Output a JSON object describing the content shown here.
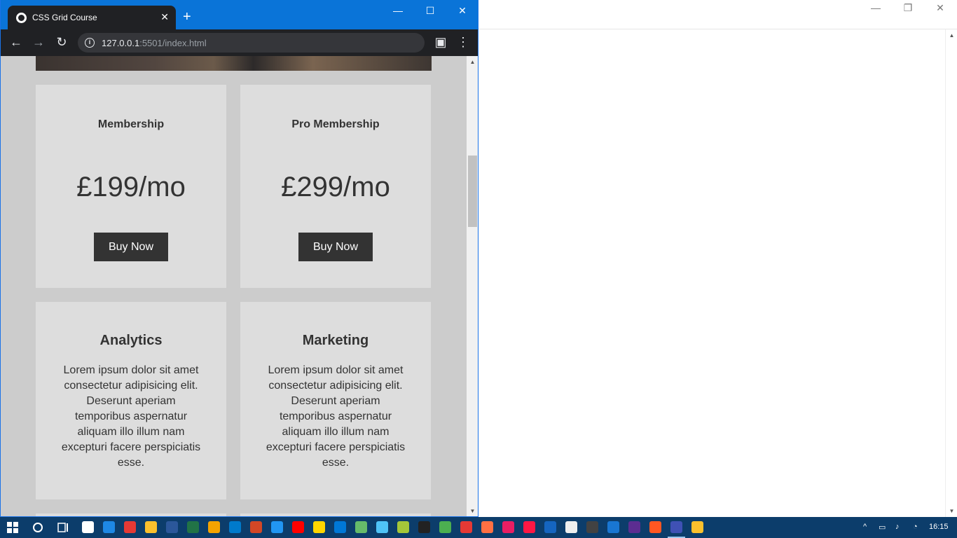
{
  "browser": {
    "tab_title": "CSS Grid Course",
    "tab_close": "✕",
    "new_tab": "+",
    "url_host": "127.0.0.1",
    "url_rest": ":5501/index.html",
    "minimize": "—",
    "maximize": "☐",
    "close": "✕"
  },
  "pricing": [
    {
      "title": "Membership",
      "price": "£199/mo",
      "button": "Buy Now"
    },
    {
      "title": "Pro Membership",
      "price": "£299/mo",
      "button": "Buy Now"
    }
  ],
  "features": [
    {
      "title": "Analytics",
      "text": "Lorem ipsum dolor sit amet consectetur adipisicing elit. Deserunt aperiam temporibus aspernatur aliquam illo illum nam excepturi facere perspiciatis esse."
    },
    {
      "title": "Marketing",
      "text": "Lorem ipsum dolor sit amet consectetur adipisicing elit. Deserunt aperiam temporibus aspernatur aliquam illo illum nam excepturi facere perspiciatis esse."
    }
  ],
  "right_window": {
    "minimize": "—",
    "restore": "❐",
    "close": "✕"
  },
  "taskbar": {
    "time": "16:15",
    "app_colors": [
      "#ffffff",
      "#1e88e5",
      "#e53935",
      "#fbc02d",
      "#2b579a",
      "#217346",
      "#f4a300",
      "#007acc",
      "#d24726",
      "#2196f3",
      "#ff0000",
      "#ffd600",
      "#0078d7",
      "#66bb6a",
      "#4fc3f7",
      "#a4c639",
      "#222222",
      "#4caf50",
      "#e53935",
      "#ff7043",
      "#e91e63",
      "#ff1744",
      "#1565c0",
      "#eeeeee",
      "#424242",
      "#1976d2",
      "#5c2d91",
      "#ff5722",
      "#3f51b5",
      "#fbc02d"
    ]
  }
}
